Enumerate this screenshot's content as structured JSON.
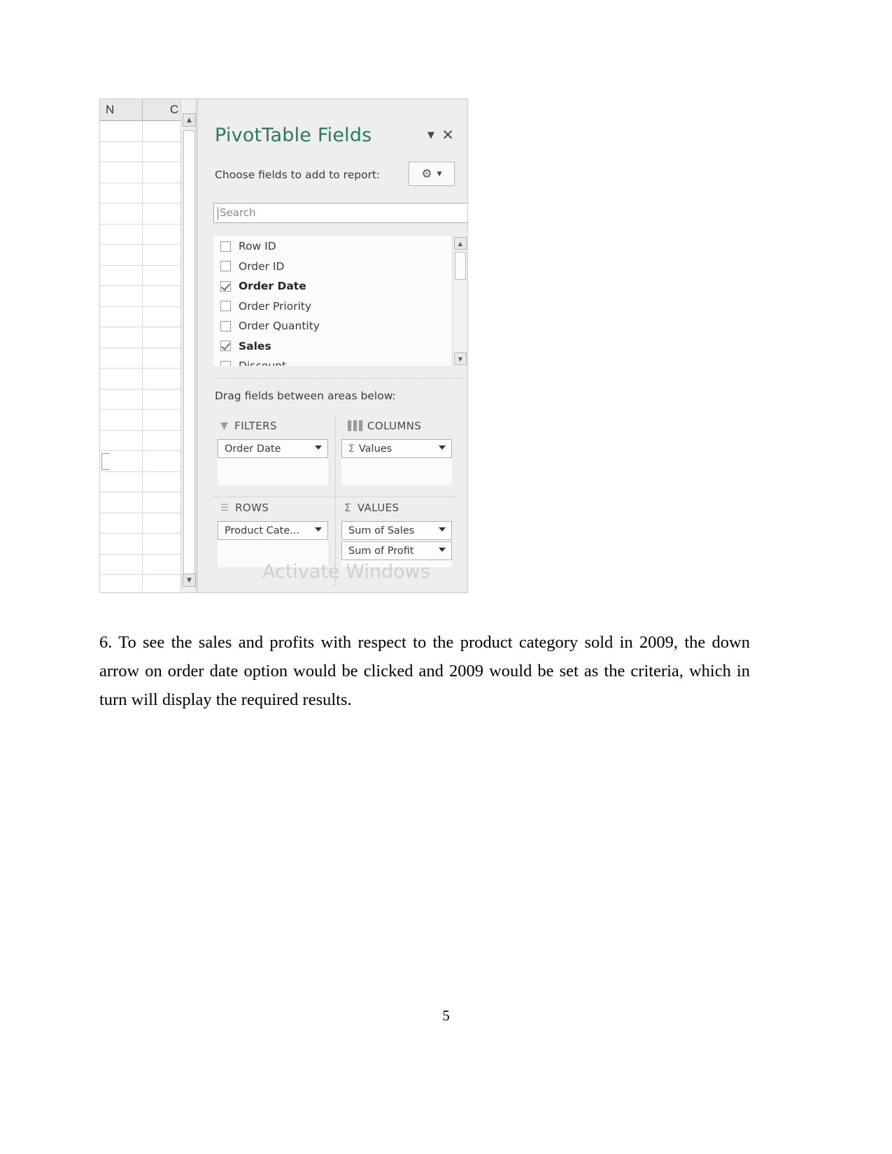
{
  "figure": {
    "spreadsheet": {
      "column_headers": [
        "N",
        "C"
      ]
    },
    "pane": {
      "title": "PivotTable Fields",
      "collapse_icon": "chevron-down-icon",
      "close_icon": "close-icon",
      "choose_label": "Choose fields to add to report:",
      "tools_button": {
        "icon": "gear-icon",
        "dropdown": "chevron-down-icon"
      },
      "search": {
        "placeholder": "Search",
        "icon": "search-icon"
      },
      "fields": [
        {
          "label": "Row ID",
          "checked": false
        },
        {
          "label": "Order ID",
          "checked": false
        },
        {
          "label": "Order Date",
          "checked": true,
          "filter_icon": "funnel-icon"
        },
        {
          "label": "Order Priority",
          "checked": false
        },
        {
          "label": "Order Quantity",
          "checked": false
        },
        {
          "label": "Sales",
          "checked": true
        },
        {
          "label": "Discount",
          "checked": false
        }
      ],
      "drag_label": "Drag fields between areas below:",
      "areas": [
        {
          "key": "filters",
          "title": "FILTERS",
          "icon": "funnel-icon",
          "chips": [
            {
              "label": "Order Date",
              "sigma": false
            }
          ]
        },
        {
          "key": "columns",
          "title": "COLUMNS",
          "icon": "columns-icon",
          "chips": [
            {
              "label": "Values",
              "sigma": true
            }
          ]
        },
        {
          "key": "rows",
          "title": "ROWS",
          "icon": "rows-icon",
          "chips": [
            {
              "label": "Product Cate...",
              "sigma": false
            }
          ]
        },
        {
          "key": "values",
          "title": "VALUES",
          "icon": "sigma-icon",
          "chips": [
            {
              "label": "Sum of Sales",
              "sigma": false
            },
            {
              "label": "Sum of Profit",
              "sigma": false
            }
          ]
        }
      ],
      "watermark": "Activate Windows"
    }
  },
  "document": {
    "paragraph": "6. To see the sales and profits with respect to the product category sold in 2009, the down arrow on order date option would be clicked and 2009 would be set as the criteria, which in turn will display the required results.",
    "page_number": "5"
  },
  "colors": {
    "pane_title": "#2a7a5e",
    "pane_background": "#eeeeee",
    "search_icon": "#2a6fb8",
    "watermark": "#cfcfcf"
  }
}
